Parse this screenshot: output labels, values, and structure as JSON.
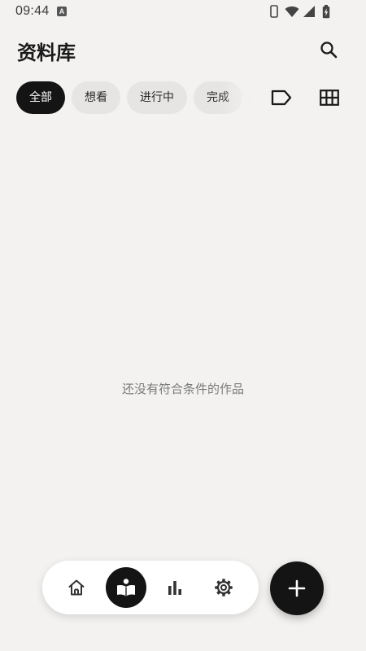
{
  "status_bar": {
    "time": "09:44",
    "keyboard_indicator": "A",
    "icons": [
      "phone-icon",
      "wifi-icon",
      "cell-signal-icon",
      "battery-charging-icon"
    ]
  },
  "header": {
    "title": "资料库",
    "search_icon": "search-icon"
  },
  "filters": {
    "chips": [
      {
        "label": "全部",
        "active": true
      },
      {
        "label": "想看",
        "active": false
      },
      {
        "label": "进行中",
        "active": false
      },
      {
        "label": "完成",
        "active": false
      }
    ],
    "tag_icon": "tag-icon",
    "grid_icon": "grid-view-icon"
  },
  "main": {
    "empty_message": "还没有符合条件的作品"
  },
  "bottom_nav": {
    "items": [
      {
        "name": "home",
        "icon": "home-icon",
        "active": false
      },
      {
        "name": "library",
        "icon": "book-icon",
        "active": true
      },
      {
        "name": "stats",
        "icon": "bar-chart-icon",
        "active": false
      },
      {
        "name": "settings",
        "icon": "gear-icon",
        "active": false
      }
    ]
  },
  "fab": {
    "icon": "plus-icon"
  },
  "colors": {
    "background": "#f3f2f0",
    "accent": "#141414",
    "chip_inactive": "#e6e5e3",
    "muted_text": "#7a7a7a"
  }
}
